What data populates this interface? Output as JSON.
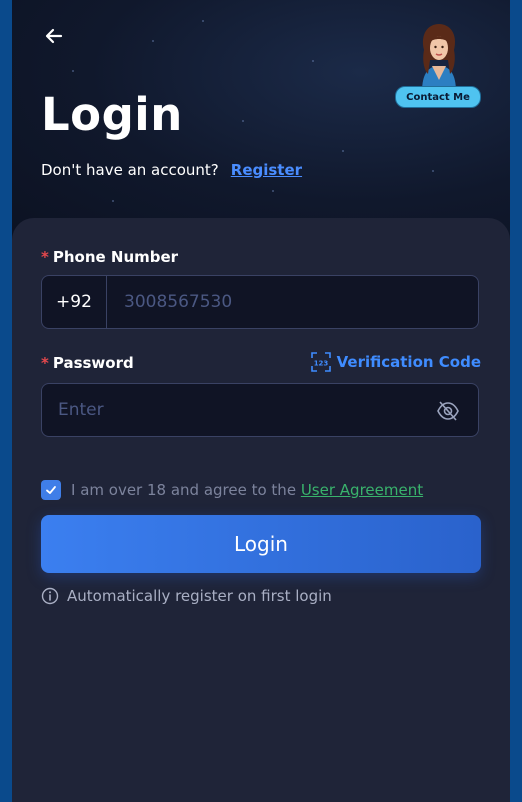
{
  "header": {
    "title": "Login",
    "subtitle": "Don't have an account?",
    "register_link": "Register",
    "contact_label": "Contact Me"
  },
  "form": {
    "phone": {
      "label": "Phone Number",
      "country_code": "+92",
      "value": "",
      "placeholder": "3008567530"
    },
    "password": {
      "label": "Password",
      "alt_method_label": "Verification Code",
      "value": "",
      "placeholder": "Enter"
    },
    "agreement": {
      "checked": true,
      "text": "I am over 18 and agree to the",
      "link": "User Agreement"
    },
    "submit_label": "Login",
    "auto_register_note": "Automatically register on first login"
  },
  "icons": {
    "back": "arrow-left-icon",
    "verification": "verification-code-icon",
    "visibility": "eye-off-icon",
    "info": "info-icon",
    "checkbox": "checkmark-icon"
  },
  "colors": {
    "accent": "#3f8cff",
    "button": "#3b7ff0",
    "required": "#e5484d",
    "agreement_link": "#39b36c",
    "contact_button": "#4fc3f0"
  }
}
